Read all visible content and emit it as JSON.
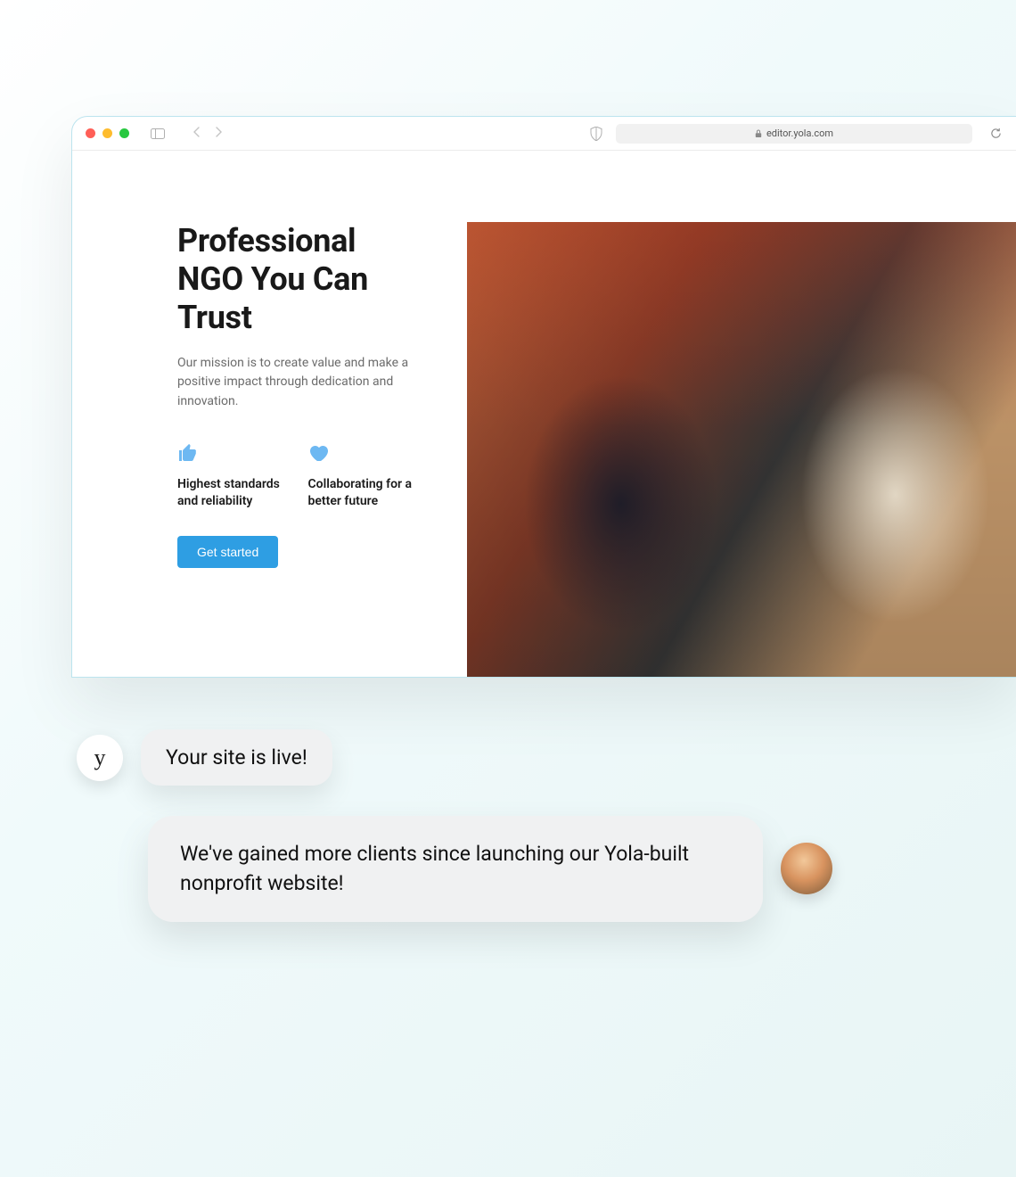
{
  "browser": {
    "url": "editor.yola.com",
    "traffic_colors": {
      "red": "#ff5f57",
      "yellow": "#febc2e",
      "green": "#28c840"
    }
  },
  "page": {
    "heading": "Professional NGO You Can Trust",
    "mission": "Our mission is to create value and make a positive impact through dedication and innovation.",
    "features": [
      {
        "icon": "thumbs-up-icon",
        "text": "Highest standards and reliability"
      },
      {
        "icon": "heart-icon",
        "text": "Collaborating for a better future"
      }
    ],
    "cta_label": "Get started"
  },
  "chat": {
    "brand_glyph": "y",
    "bubble1": "Your site is live!",
    "bubble2": "We've gained more clients since launching our Yola-built nonprofit website!"
  },
  "colors": {
    "accent_blue": "#2e9ee3",
    "icon_blue": "#6db8f2",
    "text_dark": "#191919",
    "text_muted": "#6b6b6b"
  }
}
